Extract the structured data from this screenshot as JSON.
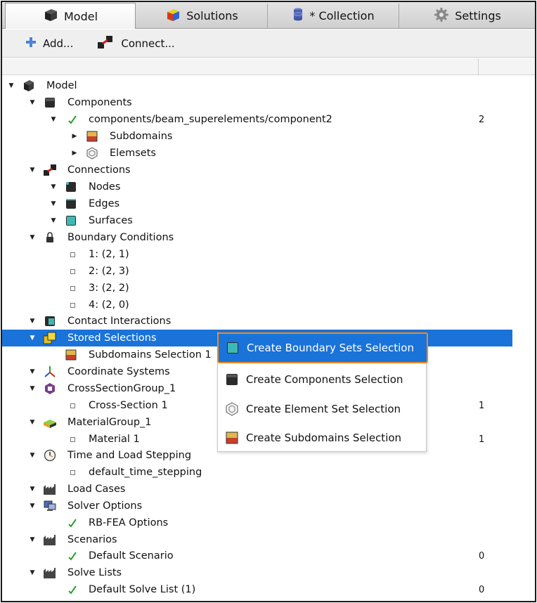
{
  "tabs": [
    {
      "label": "Model",
      "icon": "model-cube-icon",
      "active": true
    },
    {
      "label": "Solutions",
      "icon": "solutions-cube-icon",
      "active": false
    },
    {
      "label": "* Collection",
      "icon": "collection-database-icon",
      "active": false
    },
    {
      "label": "Settings",
      "icon": "settings-gear-icon",
      "active": false
    }
  ],
  "toolbar": {
    "add_label": "Add...",
    "connect_label": "Connect..."
  },
  "tree": {
    "rows": [
      {
        "label": "Model",
        "value": ""
      },
      {
        "label": "Components",
        "value": ""
      },
      {
        "label": "components/beam_superelements/component2",
        "value": "2"
      },
      {
        "label": "Subdomains",
        "value": ""
      },
      {
        "label": "Elemsets",
        "value": ""
      },
      {
        "label": "Connections",
        "value": ""
      },
      {
        "label": "Nodes",
        "value": ""
      },
      {
        "label": "Edges",
        "value": ""
      },
      {
        "label": "Surfaces",
        "value": ""
      },
      {
        "label": "Boundary Conditions",
        "value": ""
      },
      {
        "label": "1: (2, 1)",
        "value": ""
      },
      {
        "label": "2: (2, 3)",
        "value": ""
      },
      {
        "label": "3: (2, 2)",
        "value": ""
      },
      {
        "label": "4: (2, 0)",
        "value": ""
      },
      {
        "label": "Contact Interactions",
        "value": ""
      },
      {
        "label": "Stored Selections",
        "value": ""
      },
      {
        "label": "Subdomains Selection 1",
        "value": ""
      },
      {
        "label": "Coordinate Systems",
        "value": ""
      },
      {
        "label": "CrossSectionGroup_1",
        "value": ""
      },
      {
        "label": "Cross-Section 1",
        "value": "1"
      },
      {
        "label": "MaterialGroup_1",
        "value": ""
      },
      {
        "label": "Material 1",
        "value": "1"
      },
      {
        "label": "Time and Load Stepping",
        "value": ""
      },
      {
        "label": "default_time_stepping",
        "value": ""
      },
      {
        "label": "Load Cases",
        "value": ""
      },
      {
        "label": "Solver Options",
        "value": ""
      },
      {
        "label": "RB-FEA Options",
        "value": ""
      },
      {
        "label": "Scenarios",
        "value": ""
      },
      {
        "label": "Default Scenario",
        "value": "0"
      },
      {
        "label": "Solve Lists",
        "value": ""
      },
      {
        "label": "Default Solve List (1)",
        "value": "0"
      }
    ]
  },
  "context_menu": {
    "items": [
      {
        "label": "Create Boundary Sets Selection",
        "icon": "boundary-cube-icon"
      },
      {
        "label": "Create Components Selection",
        "icon": "component-cube-icon"
      },
      {
        "label": "Create Element Set Selection",
        "icon": "elemset-hexagon-icon"
      },
      {
        "label": "Create Subdomains Selection",
        "icon": "subdomain-cube-icon"
      }
    ]
  },
  "colors": {
    "selection": "#1a73d9",
    "menu_highlight_border": "#ef8a1f"
  }
}
